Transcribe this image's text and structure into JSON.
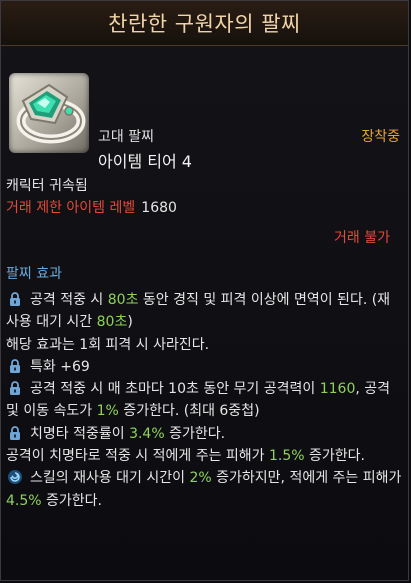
{
  "title": "찬란한 구원자의 팔찌",
  "header": {
    "grade": "고대 팔찌",
    "tier": "아이템 티어 4",
    "equipped": "장착중"
  },
  "info": {
    "bound": "캐릭터 귀속됨",
    "trade_level_label": "거래 제한 아이템 레벨",
    "trade_level_value": "1680",
    "no_trade": "거래 불가"
  },
  "section_title": "팔찌 효과",
  "effects": {
    "e1": {
      "t1": "공격 적중 시 ",
      "h1": "80초",
      "t2": " 동안 경직 및 피격 이상에 면역이 된다. (재사용 대기 시간 ",
      "h2": "80초",
      "t3": ")"
    },
    "e1_note": "해당 효과는 1회 피격 시 사라진다.",
    "e2": "특화 +69",
    "e3": {
      "t1": "공격 적중 시 매 초마다 10초 동안 무기 공격력이 ",
      "h1": "1160",
      "t2": ", 공격 및 이동 속도가 ",
      "h2": "1%",
      "t3": " 증가한다. (최대 6중첩)"
    },
    "e4": {
      "t1": "치명타 적중률이 ",
      "h1": "3.4%",
      "t2": " 증가한다."
    },
    "e4_note": {
      "t1": "공격이 치명타로 적중 시 적에게 주는 피해가 ",
      "h1": "1.5%",
      "t2": " 증가한다."
    },
    "e5": {
      "t1": "스킬의 재사용 대기 시간이 ",
      "h1": "2%",
      "t2": " 증가하지만, 적에게 주는 피해가 ",
      "h2": "4.5%",
      "t3": " 증가한다."
    }
  },
  "icons": {
    "item": "jeweled-bracelet-icon",
    "effect_locked": "lock-icon",
    "effect_special": "swirl-icon"
  },
  "colors": {
    "title": "#f0d4a8",
    "equipped": "#e8a234",
    "warning": "#e04a3a",
    "section": "#68a8d8",
    "highlight": "#8ed25a"
  }
}
